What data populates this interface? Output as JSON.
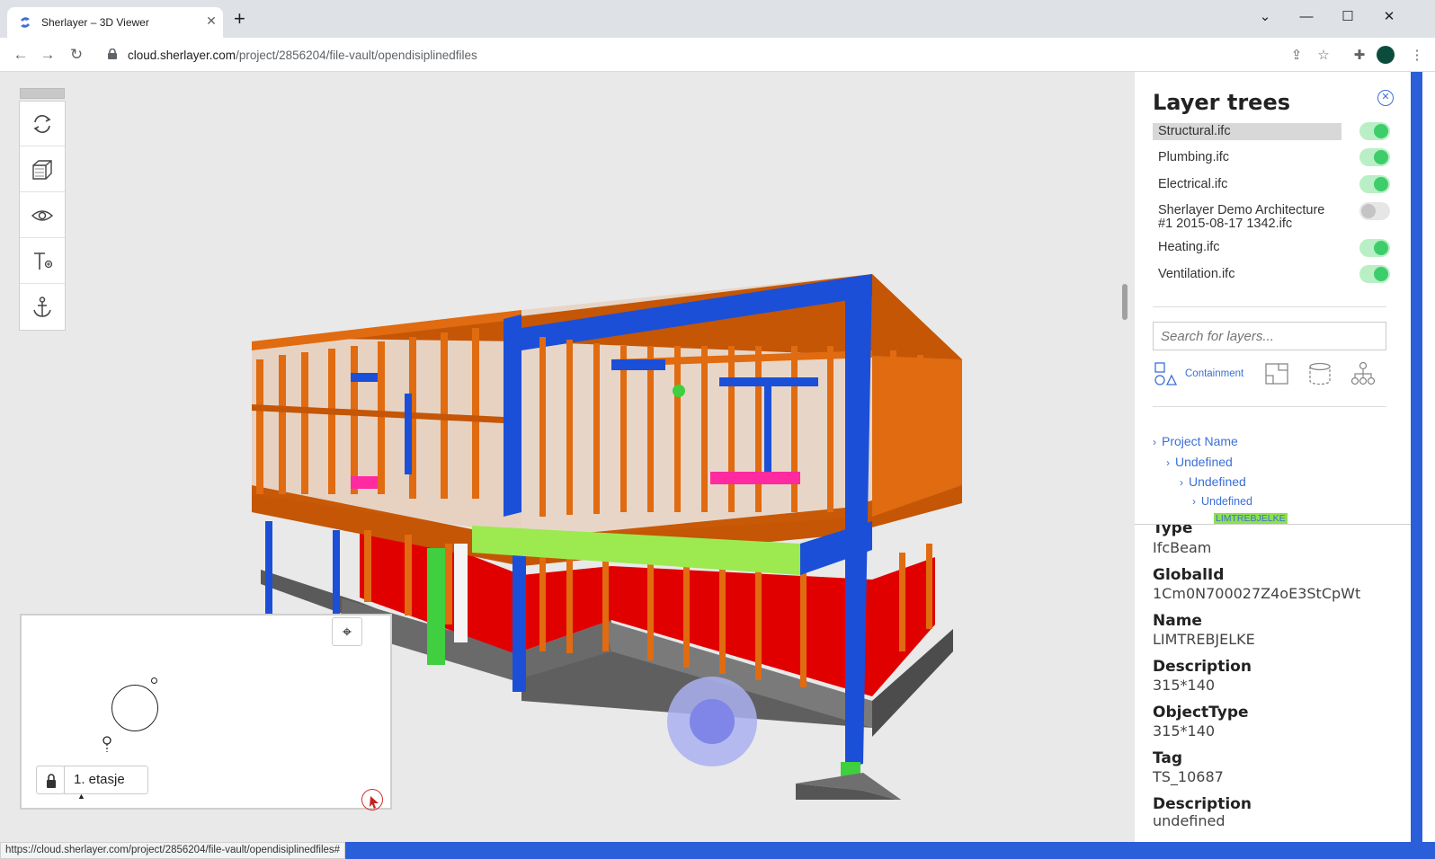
{
  "browser": {
    "tab_title": "Sherlayer – 3D Viewer",
    "tab_close": "✕",
    "new_tab": "+",
    "url_host": "cloud.sherlayer.com",
    "url_path": "/project/2856204/file-vault/opendisiplinedfiles",
    "status_url": "https://cloud.sherlayer.com/project/2856204/file-vault/opendisiplinedfiles#"
  },
  "tools": [
    {
      "icon": "rotate-icon"
    },
    {
      "icon": "cube-icon"
    },
    {
      "icon": "eye-icon"
    },
    {
      "icon": "text-tool-icon"
    },
    {
      "icon": "anchor-icon"
    }
  ],
  "minimap": {
    "floor_label": "1. etasje"
  },
  "panel": {
    "title": "Layer trees",
    "layers": [
      {
        "name": "Structural.ifc",
        "on": true,
        "selected": true
      },
      {
        "name": "Plumbing.ifc",
        "on": true
      },
      {
        "name": "Electrical.ifc",
        "on": true
      },
      {
        "name": "Sherlayer Demo Architecture #1 2015-08-17 1342.ifc",
        "on": false
      },
      {
        "name": "Heating.ifc",
        "on": true
      },
      {
        "name": "Ventilation.ifc",
        "on": true
      }
    ],
    "search_placeholder": "Search for layers...",
    "view_mode": "Containment",
    "tree": [
      "Project Name",
      "Undefined",
      "Undefined",
      "Undefined"
    ],
    "tree_selected": "LIMTREBJELKE",
    "properties": [
      {
        "key": "Type",
        "value": "IfcBeam"
      },
      {
        "key": "GlobalId",
        "value": "1Cm0N700027Z4oE3StCpWt"
      },
      {
        "key": "Name",
        "value": "LIMTREBJELKE"
      },
      {
        "key": "Description",
        "value": "315*140"
      },
      {
        "key": "ObjectType",
        "value": "315*140"
      },
      {
        "key": "Tag",
        "value": "TS_10687"
      },
      {
        "key": "Description",
        "value": "undefined"
      }
    ]
  },
  "colors": {
    "accent": "#3a6fd8",
    "toggle_on": "#3dcd6a",
    "timber": "#e06b10",
    "steel": "#1b4fd8",
    "highlight": "#9cea4f"
  }
}
